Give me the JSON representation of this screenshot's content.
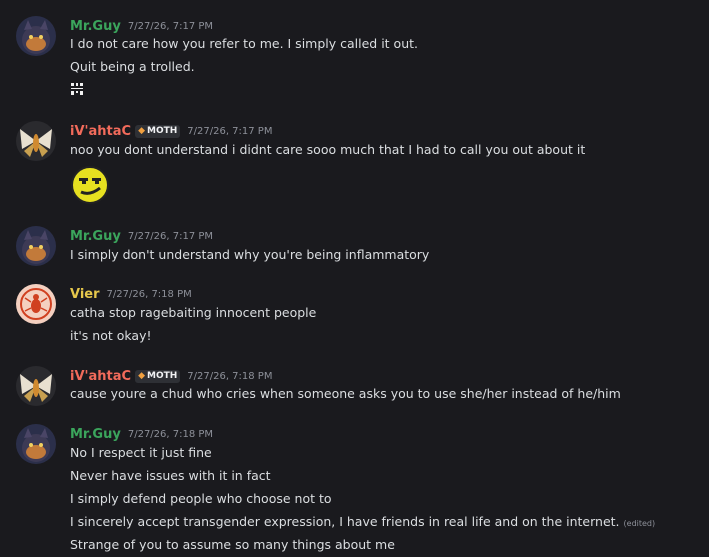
{
  "colors": {
    "background": "#1a1a1e",
    "mrguy": "#3ba55c",
    "ivahtac": "#f26b5b",
    "vier": "#e6c84c",
    "text": "#dbdee1",
    "timestamp": "#8d9099"
  },
  "messages": [
    {
      "author": "Mr.Guy",
      "timestamp": "7/27/26, 7:17 PM",
      "lines": [
        "I do not care how you refer to me. I simply called it out.",
        "Quit being a trolled."
      ],
      "attachment": "qr-sticker-icon"
    },
    {
      "author": "iV'ahtaC",
      "tag": "MOTH",
      "timestamp": "7/27/26, 7:17 PM",
      "lines": [
        "noo you dont understand i didnt care sooo much that I had to call you out about it"
      ],
      "attachment": "smug-face-sticker-icon"
    },
    {
      "author": "Mr.Guy",
      "timestamp": "7/27/26, 7:17 PM",
      "lines": [
        "I simply don't understand why you're being inflammatory"
      ]
    },
    {
      "author": "Vier",
      "timestamp": "7/27/26, 7:18 PM",
      "lines": [
        "catha stop ragebaiting innocent people",
        "it's not okay!"
      ]
    },
    {
      "author": "iV'ahtaC",
      "tag": "MOTH",
      "timestamp": "7/27/26, 7:18 PM",
      "lines": [
        "cause youre a chud who cries when someone asks you to use she/her instead of he/him"
      ]
    },
    {
      "author": "Mr.Guy",
      "timestamp": "7/27/26, 7:18 PM",
      "lines": [
        "No I respect it just fine",
        "Never have issues with it in fact",
        "I simply defend people who choose not to",
        "I sincerely accept transgender expression, I have friends in real life and on the internet.",
        "Strange of you to assume so many things about me"
      ],
      "edited_label": "(edited)"
    }
  ]
}
